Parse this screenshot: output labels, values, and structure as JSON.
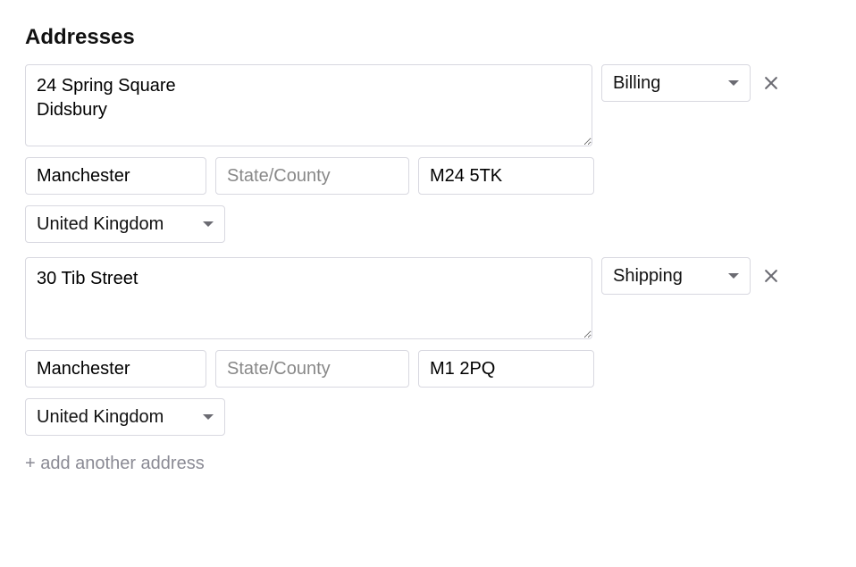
{
  "section": {
    "title": "Addresses"
  },
  "addresses": [
    {
      "street": "24 Spring Square\nDidsbury",
      "city": "Manchester",
      "state": "",
      "state_placeholder": "State/County",
      "postal": "M24 5TK",
      "country": "United Kingdom",
      "type": "Billing"
    },
    {
      "street": "30 Tib Street",
      "city": "Manchester",
      "state": "",
      "state_placeholder": "State/County",
      "postal": "M1 2PQ",
      "country": "United Kingdom",
      "type": "Shipping"
    }
  ],
  "actions": {
    "add_address": "+ add another address"
  }
}
